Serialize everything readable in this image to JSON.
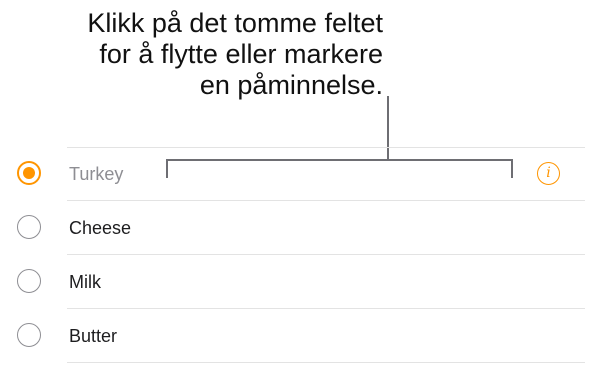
{
  "callout": {
    "lines": [
      "Klikk på det tomme feltet",
      "for å flytte eller markere",
      "en påminnelse."
    ]
  },
  "reminders": [
    {
      "title": "Turkey",
      "completed": true
    },
    {
      "title": "Cheese",
      "completed": false
    },
    {
      "title": "Milk",
      "completed": false
    },
    {
      "title": "Butter",
      "completed": false
    }
  ],
  "colors": {
    "accent": "#ff9500",
    "divider": "#e3e3e3",
    "text": "#1d1d1f",
    "muted_text": "#8e8e93"
  },
  "icons": {
    "selected_row_info": "info-icon",
    "completed_marker": "radio-checked-icon",
    "open_marker": "radio-empty-icon"
  }
}
